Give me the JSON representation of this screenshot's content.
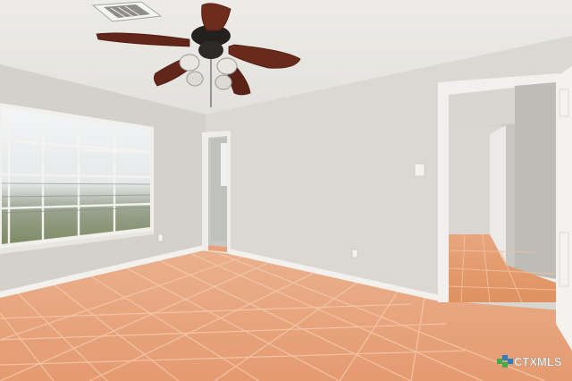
{
  "watermark": {
    "brand": "CTXMLS",
    "icon": "ctxmls-logo-icon",
    "colors": {
      "green": "#3fae49",
      "blue": "#2a7dc0",
      "text": "#ffffff"
    }
  },
  "colors": {
    "wall": "#d8d7d2",
    "wall_shade": "#c9c8c3",
    "ceiling": "#e9e8e4",
    "floor_tile": "#e8a27a",
    "grout": "#f1c2a2",
    "trim": "#f4f3ef",
    "fan_blade": "#6b2a1c",
    "window_light": "#eef1f3"
  }
}
